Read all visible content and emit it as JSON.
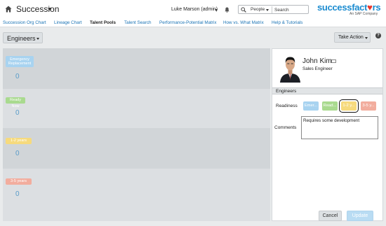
{
  "header": {
    "app_title": "Succession",
    "user_name": "Luke Marson (admin)",
    "search_scope": "People",
    "search_placeholder": "Search",
    "logo_main_a": "successfact",
    "logo_main_b": "rs",
    "logo_sub": "An SAP Company"
  },
  "nav": {
    "items": [
      {
        "label": "Succession Org Chart"
      },
      {
        "label": "Lineage Chart"
      },
      {
        "label": "Talent Pools"
      },
      {
        "label": "Talent Search"
      },
      {
        "label": "Performance-Potential Matrix"
      },
      {
        "label": "How vs. What Matrix"
      },
      {
        "label": "Help & Tutorials"
      }
    ],
    "active": "Talent Pools"
  },
  "toolbar": {
    "pool_filter": "Engineers",
    "take_action": "Take Action"
  },
  "rows": [
    {
      "label": "Emergency Replacement",
      "count": "0",
      "color": "#a8d3f0"
    },
    {
      "label": "Ready Now",
      "count": "0",
      "color": "#a9da8f"
    },
    {
      "label": "1-2 years",
      "count": "0",
      "color": "#f6da7d"
    },
    {
      "label": "3-5 years",
      "count": "0",
      "color": "#f2ad9e"
    }
  ],
  "panel": {
    "name": "John Kim",
    "title": "Sales Engineer",
    "section": "Engineers",
    "readiness_label": "Readiness",
    "readiness_options": [
      {
        "label": "Emer...",
        "color": "#a8d3f0"
      },
      {
        "label": "Read...",
        "color": "#a9da8f"
      },
      {
        "label": "1-2 y...",
        "color": "#f6da7d",
        "selected": true
      },
      {
        "label": "3-5 y...",
        "color": "#f2ad9e"
      }
    ],
    "comments_label": "Comments",
    "comments_value": "Requires some development",
    "cancel_label": "Cancel",
    "update_label": "Update"
  }
}
